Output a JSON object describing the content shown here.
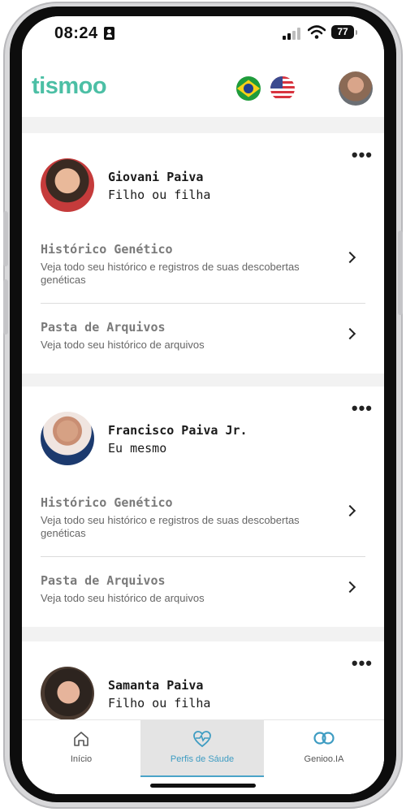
{
  "status_bar": {
    "time": "08:24",
    "battery": "77"
  },
  "header": {
    "logo": "tismoo"
  },
  "cards": [
    {
      "name": "Giovani Paiva",
      "relation": "Filho ou filha",
      "more": "•••",
      "rows": [
        {
          "title": "Histórico Genético",
          "desc": "Veja todo seu histórico e registros de suas descobertas genéticas"
        },
        {
          "title": "Pasta de Arquivos",
          "desc": "Veja todo seu histórico de arquivos"
        }
      ]
    },
    {
      "name": "Francisco Paiva Jr.",
      "relation": "Eu mesmo",
      "more": "•••",
      "rows": [
        {
          "title": "Histórico Genético",
          "desc": "Veja todo seu histórico e registros de suas descobertas genéticas"
        },
        {
          "title": "Pasta de Arquivos",
          "desc": "Veja todo seu histórico de arquivos"
        }
      ]
    },
    {
      "name": "Samanta Paiva",
      "relation": "Filho ou filha",
      "more": "•••"
    }
  ],
  "tabs": [
    {
      "label": "Início",
      "icon": "home-icon"
    },
    {
      "label": "Perfis de Sáude",
      "icon": "heart-pulse-icon"
    },
    {
      "label": "Genioo.IA",
      "icon": "infinity-icon"
    }
  ],
  "colors": {
    "brand": "#4cbfa5",
    "active_tab": "#3e9cc2"
  }
}
